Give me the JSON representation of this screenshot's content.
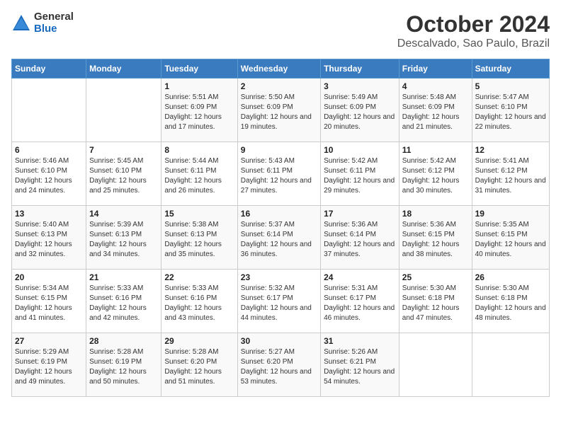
{
  "logo": {
    "general": "General",
    "blue": "Blue"
  },
  "title": "October 2024",
  "subtitle": "Descalvado, Sao Paulo, Brazil",
  "days_header": [
    "Sunday",
    "Monday",
    "Tuesday",
    "Wednesday",
    "Thursday",
    "Friday",
    "Saturday"
  ],
  "weeks": [
    [
      {
        "day": "",
        "sunrise": "",
        "sunset": "",
        "daylight": ""
      },
      {
        "day": "",
        "sunrise": "",
        "sunset": "",
        "daylight": ""
      },
      {
        "day": "1",
        "sunrise": "Sunrise: 5:51 AM",
        "sunset": "Sunset: 6:09 PM",
        "daylight": "Daylight: 12 hours and 17 minutes."
      },
      {
        "day": "2",
        "sunrise": "Sunrise: 5:50 AM",
        "sunset": "Sunset: 6:09 PM",
        "daylight": "Daylight: 12 hours and 19 minutes."
      },
      {
        "day": "3",
        "sunrise": "Sunrise: 5:49 AM",
        "sunset": "Sunset: 6:09 PM",
        "daylight": "Daylight: 12 hours and 20 minutes."
      },
      {
        "day": "4",
        "sunrise": "Sunrise: 5:48 AM",
        "sunset": "Sunset: 6:09 PM",
        "daylight": "Daylight: 12 hours and 21 minutes."
      },
      {
        "day": "5",
        "sunrise": "Sunrise: 5:47 AM",
        "sunset": "Sunset: 6:10 PM",
        "daylight": "Daylight: 12 hours and 22 minutes."
      }
    ],
    [
      {
        "day": "6",
        "sunrise": "Sunrise: 5:46 AM",
        "sunset": "Sunset: 6:10 PM",
        "daylight": "Daylight: 12 hours and 24 minutes."
      },
      {
        "day": "7",
        "sunrise": "Sunrise: 5:45 AM",
        "sunset": "Sunset: 6:10 PM",
        "daylight": "Daylight: 12 hours and 25 minutes."
      },
      {
        "day": "8",
        "sunrise": "Sunrise: 5:44 AM",
        "sunset": "Sunset: 6:11 PM",
        "daylight": "Daylight: 12 hours and 26 minutes."
      },
      {
        "day": "9",
        "sunrise": "Sunrise: 5:43 AM",
        "sunset": "Sunset: 6:11 PM",
        "daylight": "Daylight: 12 hours and 27 minutes."
      },
      {
        "day": "10",
        "sunrise": "Sunrise: 5:42 AM",
        "sunset": "Sunset: 6:11 PM",
        "daylight": "Daylight: 12 hours and 29 minutes."
      },
      {
        "day": "11",
        "sunrise": "Sunrise: 5:42 AM",
        "sunset": "Sunset: 6:12 PM",
        "daylight": "Daylight: 12 hours and 30 minutes."
      },
      {
        "day": "12",
        "sunrise": "Sunrise: 5:41 AM",
        "sunset": "Sunset: 6:12 PM",
        "daylight": "Daylight: 12 hours and 31 minutes."
      }
    ],
    [
      {
        "day": "13",
        "sunrise": "Sunrise: 5:40 AM",
        "sunset": "Sunset: 6:13 PM",
        "daylight": "Daylight: 12 hours and 32 minutes."
      },
      {
        "day": "14",
        "sunrise": "Sunrise: 5:39 AM",
        "sunset": "Sunset: 6:13 PM",
        "daylight": "Daylight: 12 hours and 34 minutes."
      },
      {
        "day": "15",
        "sunrise": "Sunrise: 5:38 AM",
        "sunset": "Sunset: 6:13 PM",
        "daylight": "Daylight: 12 hours and 35 minutes."
      },
      {
        "day": "16",
        "sunrise": "Sunrise: 5:37 AM",
        "sunset": "Sunset: 6:14 PM",
        "daylight": "Daylight: 12 hours and 36 minutes."
      },
      {
        "day": "17",
        "sunrise": "Sunrise: 5:36 AM",
        "sunset": "Sunset: 6:14 PM",
        "daylight": "Daylight: 12 hours and 37 minutes."
      },
      {
        "day": "18",
        "sunrise": "Sunrise: 5:36 AM",
        "sunset": "Sunset: 6:15 PM",
        "daylight": "Daylight: 12 hours and 38 minutes."
      },
      {
        "day": "19",
        "sunrise": "Sunrise: 5:35 AM",
        "sunset": "Sunset: 6:15 PM",
        "daylight": "Daylight: 12 hours and 40 minutes."
      }
    ],
    [
      {
        "day": "20",
        "sunrise": "Sunrise: 5:34 AM",
        "sunset": "Sunset: 6:15 PM",
        "daylight": "Daylight: 12 hours and 41 minutes."
      },
      {
        "day": "21",
        "sunrise": "Sunrise: 5:33 AM",
        "sunset": "Sunset: 6:16 PM",
        "daylight": "Daylight: 12 hours and 42 minutes."
      },
      {
        "day": "22",
        "sunrise": "Sunrise: 5:33 AM",
        "sunset": "Sunset: 6:16 PM",
        "daylight": "Daylight: 12 hours and 43 minutes."
      },
      {
        "day": "23",
        "sunrise": "Sunrise: 5:32 AM",
        "sunset": "Sunset: 6:17 PM",
        "daylight": "Daylight: 12 hours and 44 minutes."
      },
      {
        "day": "24",
        "sunrise": "Sunrise: 5:31 AM",
        "sunset": "Sunset: 6:17 PM",
        "daylight": "Daylight: 12 hours and 46 minutes."
      },
      {
        "day": "25",
        "sunrise": "Sunrise: 5:30 AM",
        "sunset": "Sunset: 6:18 PM",
        "daylight": "Daylight: 12 hours and 47 minutes."
      },
      {
        "day": "26",
        "sunrise": "Sunrise: 5:30 AM",
        "sunset": "Sunset: 6:18 PM",
        "daylight": "Daylight: 12 hours and 48 minutes."
      }
    ],
    [
      {
        "day": "27",
        "sunrise": "Sunrise: 5:29 AM",
        "sunset": "Sunset: 6:19 PM",
        "daylight": "Daylight: 12 hours and 49 minutes."
      },
      {
        "day": "28",
        "sunrise": "Sunrise: 5:28 AM",
        "sunset": "Sunset: 6:19 PM",
        "daylight": "Daylight: 12 hours and 50 minutes."
      },
      {
        "day": "29",
        "sunrise": "Sunrise: 5:28 AM",
        "sunset": "Sunset: 6:20 PM",
        "daylight": "Daylight: 12 hours and 51 minutes."
      },
      {
        "day": "30",
        "sunrise": "Sunrise: 5:27 AM",
        "sunset": "Sunset: 6:20 PM",
        "daylight": "Daylight: 12 hours and 53 minutes."
      },
      {
        "day": "31",
        "sunrise": "Sunrise: 5:26 AM",
        "sunset": "Sunset: 6:21 PM",
        "daylight": "Daylight: 12 hours and 54 minutes."
      },
      {
        "day": "",
        "sunrise": "",
        "sunset": "",
        "daylight": ""
      },
      {
        "day": "",
        "sunrise": "",
        "sunset": "",
        "daylight": ""
      }
    ]
  ]
}
